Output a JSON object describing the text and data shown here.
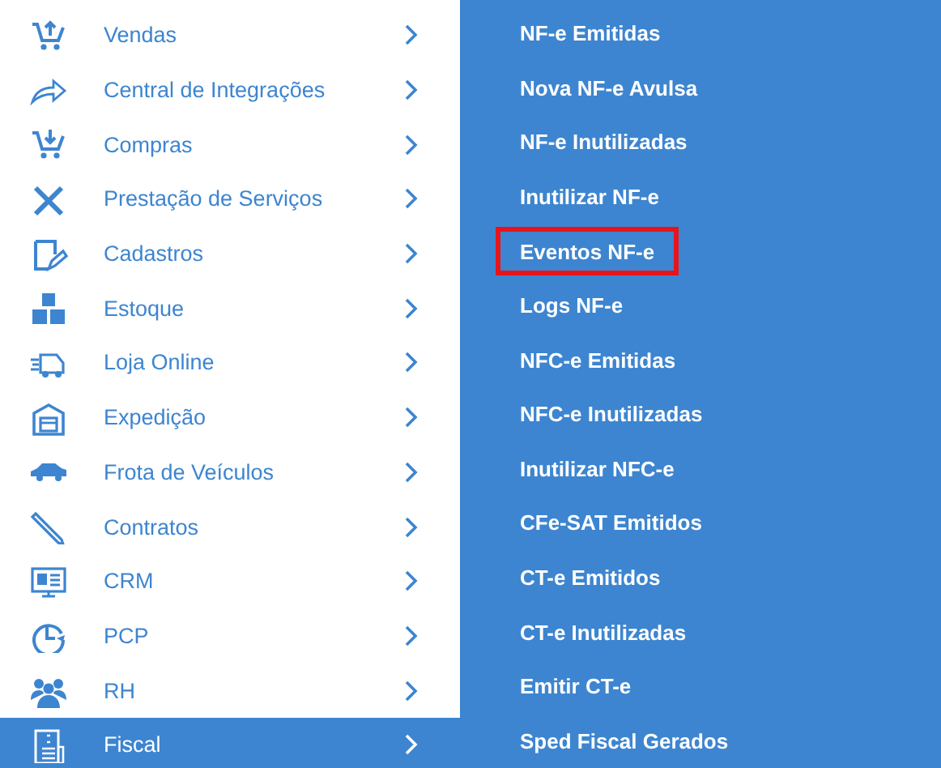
{
  "menu": {
    "items": [
      {
        "label": "Vendas",
        "selected": false
      },
      {
        "label": "Central de Integrações",
        "selected": false
      },
      {
        "label": "Compras",
        "selected": false
      },
      {
        "label": "Prestação de Serviços",
        "selected": false
      },
      {
        "label": "Cadastros",
        "selected": false
      },
      {
        "label": "Estoque",
        "selected": false
      },
      {
        "label": "Loja Online",
        "selected": false
      },
      {
        "label": "Expedição",
        "selected": false
      },
      {
        "label": "Frota de Veículos",
        "selected": false
      },
      {
        "label": "Contratos",
        "selected": false
      },
      {
        "label": "CRM",
        "selected": false
      },
      {
        "label": "PCP",
        "selected": false
      },
      {
        "label": "RH",
        "selected": false
      },
      {
        "label": "Fiscal",
        "selected": true
      }
    ]
  },
  "submenu": {
    "items": [
      {
        "label": "NF-e Emitidas",
        "highlighted": false
      },
      {
        "label": "Nova NF-e Avulsa",
        "highlighted": false
      },
      {
        "label": "NF-e Inutilizadas",
        "highlighted": false
      },
      {
        "label": "Inutilizar NF-e",
        "highlighted": false
      },
      {
        "label": "Eventos NF-e",
        "highlighted": true
      },
      {
        "label": "Logs NF-e",
        "highlighted": false
      },
      {
        "label": "NFC-e Emitidas",
        "highlighted": false
      },
      {
        "label": "NFC-e Inutilizadas",
        "highlighted": false
      },
      {
        "label": "Inutilizar NFC-e",
        "highlighted": false
      },
      {
        "label": "CFe-SAT Emitidos",
        "highlighted": false
      },
      {
        "label": "CT-e Emitidos",
        "highlighted": false
      },
      {
        "label": "CT-e Inutilizadas",
        "highlighted": false
      },
      {
        "label": "Emitir CT-e",
        "highlighted": false
      },
      {
        "label": "Sped Fiscal Gerados",
        "highlighted": false
      }
    ]
  }
}
